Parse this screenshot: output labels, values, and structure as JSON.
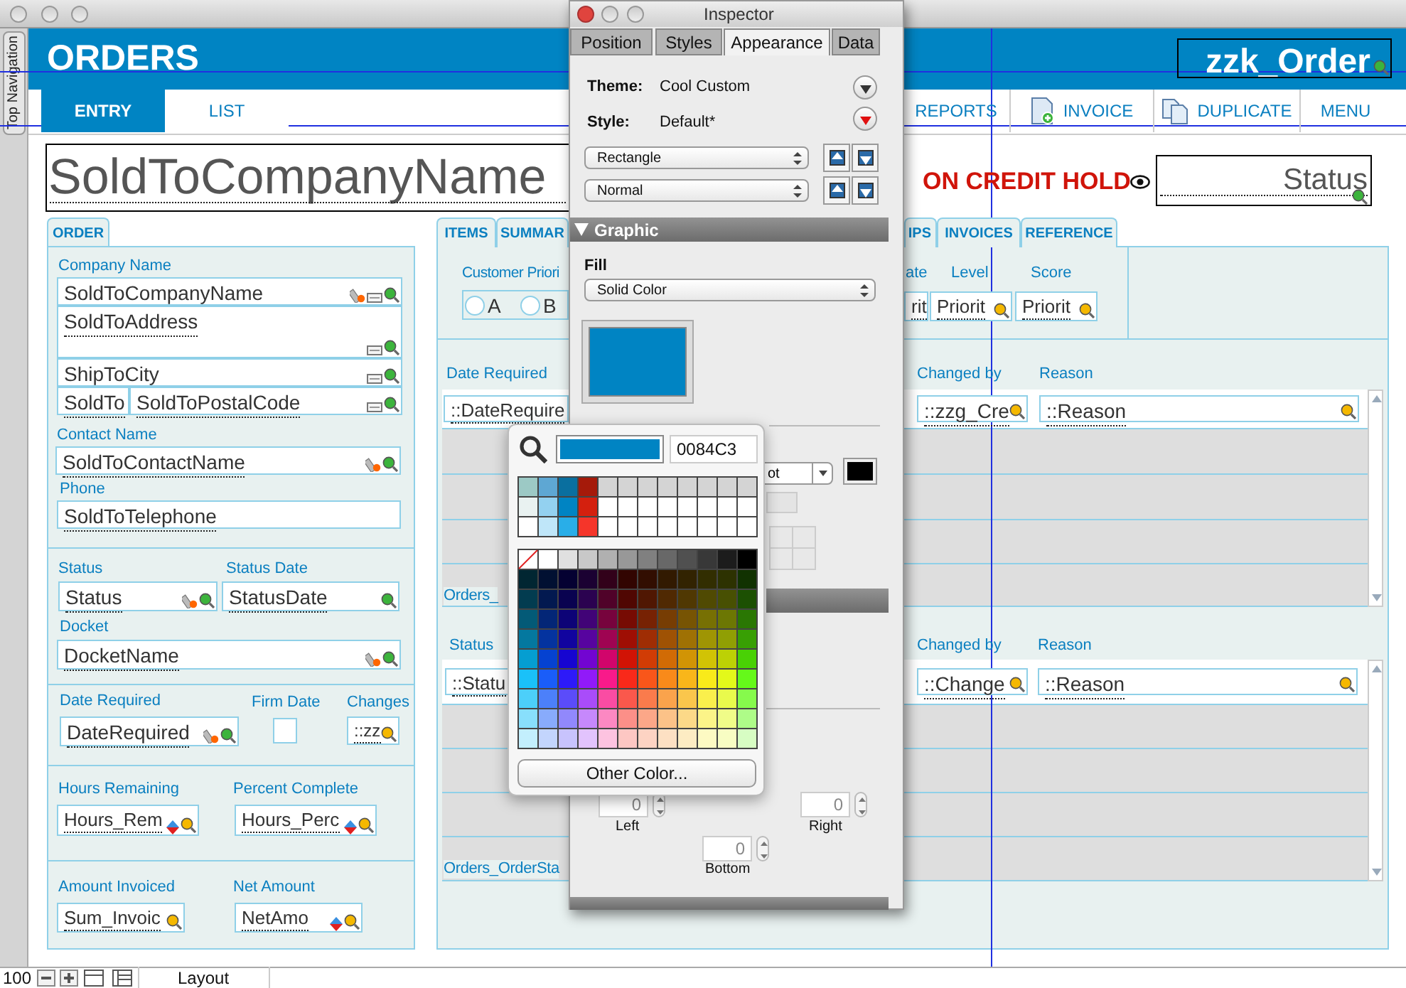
{
  "layout": {
    "side_tab": "Top Navigation",
    "header": {
      "title": "ORDERS",
      "id_field": "zzk_Order"
    },
    "nav_tabs": [
      {
        "label": "ENTRY",
        "selected": true
      },
      {
        "label": "LIST",
        "selected": false
      }
    ],
    "nav_buttons": [
      {
        "label": "REPORTS",
        "kind": "plain"
      },
      {
        "label": "INVOICE",
        "kind": "add"
      },
      {
        "label": "DUPLICATE",
        "kind": "copy"
      },
      {
        "label": "MENU",
        "kind": "plain"
      }
    ],
    "company_name_field": "SoldToCompanyName",
    "credit_hold": "ON CREDIT HOLD",
    "status_field": "Status",
    "left_panel": {
      "tab": "ORDER",
      "labels": [
        "Company Name",
        "Contact Name",
        "Phone",
        "Status",
        "Status Date",
        "Docket",
        "Date Required",
        "Firm Date",
        "Changes",
        "Hours Remaining",
        "Percent Complete",
        "Amount Invoiced",
        "Net Amount"
      ],
      "fields": [
        "SoldToCompanyName",
        "SoldToAddress",
        "ShipToCity",
        "SoldTo",
        "SoldToPostalCode",
        "SoldToContactName",
        "SoldToTelephone",
        "Status",
        "StatusDate",
        "DocketName",
        "DateRequired",
        "::zz",
        "Hours_Rem",
        "Hours_Perc",
        "Sum_Invoic",
        "NetAmo"
      ],
      "firm_date_checkbox": {
        "checked": false
      }
    },
    "right_panel": {
      "tabs": [
        "ITEMS",
        "SUMMAR",
        "IPS",
        "INVOICES",
        "REFERENCE"
      ],
      "priority": {
        "label": "Customer Priori",
        "options": [
          {
            "label": "A",
            "selected": false
          },
          {
            "label": "B",
            "selected": false
          }
        ],
        "columns": [
          "ate",
          "Level",
          "Score"
        ],
        "fields": [
          "rit",
          "Priorit",
          "Priorit"
        ]
      },
      "portals": [
        {
          "label": "Date Required",
          "columns": [
            "Changed by",
            "Reason"
          ],
          "fields": [
            "::DateRequire",
            "::zzg_Cre",
            "::Reason"
          ],
          "title": "Orders_"
        },
        {
          "label": "Status",
          "columns": [
            "Changed by",
            "Reason"
          ],
          "fields": [
            "::Statu",
            "::Change",
            "::Reason"
          ],
          "title": "Orders_OrderSta"
        }
      ]
    }
  },
  "inspector": {
    "title": "Inspector",
    "tabs": [
      {
        "label": "Position",
        "selected": false
      },
      {
        "label": "Styles",
        "selected": false
      },
      {
        "label": "Appearance",
        "selected": true
      },
      {
        "label": "Data",
        "selected": false
      }
    ],
    "theme_label": "Theme:",
    "theme": "Cool Custom",
    "style_label": "Style:",
    "style": "Default*",
    "shape_select": "Rectangle",
    "state_select": "Normal",
    "section": {
      "label": "Graphic",
      "expanded": true
    },
    "fill_label": "Fill",
    "fill_select": "Solid Color",
    "line_select": "ot",
    "line_swatch": {
      "color": "#000000"
    },
    "padding": [
      {
        "label": "Left",
        "value": "0"
      },
      {
        "label": "Right",
        "value": "0"
      },
      {
        "label": "Bottom",
        "value": "0"
      }
    ]
  },
  "color_popover": {
    "hex": "0084C3",
    "button": "Other Color..."
  },
  "status_bar": {
    "zoom": "100",
    "mode": "Layout"
  }
}
